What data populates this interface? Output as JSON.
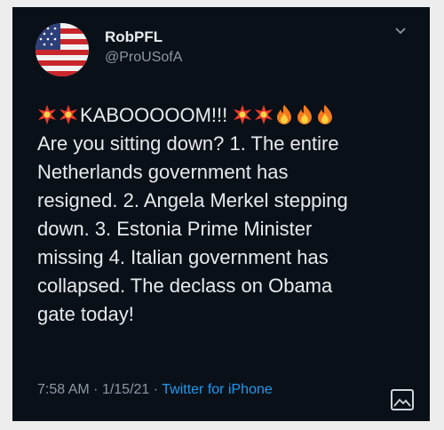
{
  "author": {
    "display_name": "RobPFL",
    "handle": "@ProUSofA",
    "avatar_icon": "us-flag-avatar"
  },
  "header": {
    "menu_icon": "chevron-down-icon"
  },
  "tweet": {
    "headline_text": "KABOOOOOM!!!",
    "lines": [
      "Are you sitting down?  1. The entire",
      "Netherlands government has",
      "resigned.  2. Angela Merkel stepping",
      "down. 3. Estonia Prime Minister",
      "missing 4.  Italian government has",
      "collapsed.    The declass on Obama",
      "gate today!"
    ]
  },
  "meta": {
    "time": "7:58 AM",
    "separator": "·",
    "date": "1/15/21",
    "source": "Twitter for iPhone"
  },
  "colors": {
    "background": "#0a1018",
    "text": "#e7ebee",
    "muted": "#8d98a3",
    "link": "#1d9bf0"
  }
}
